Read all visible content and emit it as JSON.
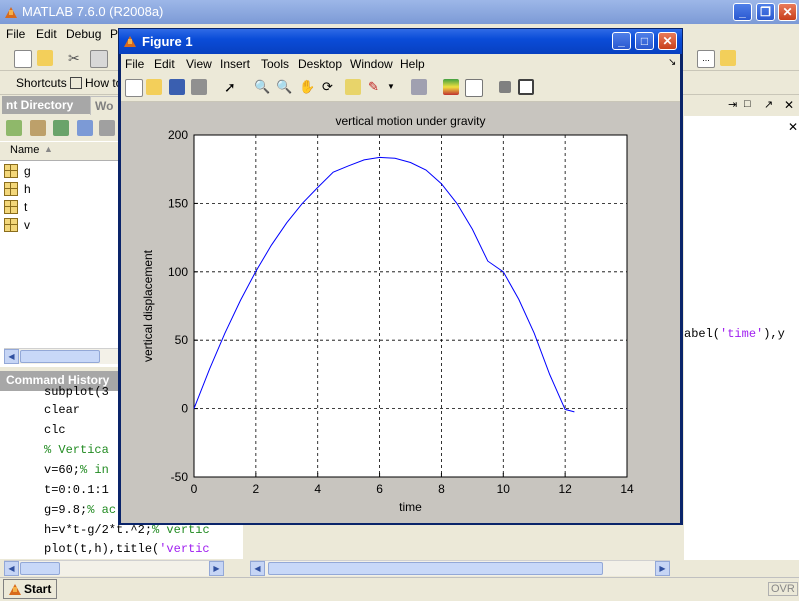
{
  "main_window": {
    "title": "MATLAB  7.6.0 (R2008a)",
    "menu": [
      "File",
      "Edit",
      "Debug",
      "P"
    ],
    "shortcuts_label": "Shortcuts",
    "howto_label": "How to"
  },
  "current_directory": {
    "tab_label": "nt Directory",
    "tab2_label": "Wo",
    "column_name": "Name",
    "files": [
      "g",
      "h",
      "t",
      "v"
    ]
  },
  "command_history": {
    "title": "Command History",
    "lines": [
      {
        "text": "subplot(3",
        "kind": "code"
      },
      {
        "text": "clear",
        "kind": "code"
      },
      {
        "text": "clc",
        "kind": "code"
      },
      {
        "text": "% Vertica",
        "kind": "comment"
      },
      {
        "code": "v=60;",
        "comment": "% in"
      },
      {
        "text": "t=0:0.1:1",
        "kind": "code"
      },
      {
        "code": "g=9.8;",
        "comment": "% ac"
      },
      {
        "code": "h=v*t-g/2*t.^2;",
        "comment": "% vertic"
      },
      {
        "code": "plot(t,h),title(",
        "string": "'vertic"
      }
    ]
  },
  "command_window": {
    "partial_line_pre": "abel(",
    "partial_line_str": "'time'",
    "partial_line_post": "),y"
  },
  "status_bar": {
    "start_label": "Start",
    "ovr_label": "OVR"
  },
  "figure_window": {
    "title": "Figure 1",
    "menu": [
      "File",
      "Edit",
      "View",
      "Insert",
      "Tools",
      "Desktop",
      "Window",
      "Help"
    ]
  },
  "chart_data": {
    "type": "line",
    "title": "vertical motion under gravity",
    "xlabel": "time",
    "ylabel": "vertical displacement",
    "xlim": [
      0,
      14
    ],
    "ylim": [
      -50,
      200
    ],
    "xticks": [
      0,
      2,
      4,
      6,
      8,
      10,
      12,
      14
    ],
    "yticks": [
      -50,
      0,
      50,
      100,
      150,
      200
    ],
    "grid": true,
    "series_color": "#0000ff",
    "series": [
      {
        "x": [
          0,
          0.5,
          1,
          1.5,
          2,
          2.5,
          3,
          3.5,
          4,
          4.5,
          5,
          5.5,
          6,
          6.5,
          7,
          7.5,
          8,
          8.5,
          9,
          9.5,
          10,
          10.5,
          11,
          11.5,
          12,
          12.3
        ],
        "values": [
          0,
          28.8,
          55.1,
          79.0,
          100.4,
          119.4,
          135.9,
          150.0,
          161.6,
          172.8,
          177.5,
          181.8,
          183.6,
          183.0,
          179.9,
          174.4,
          164.4,
          150.0,
          131.1,
          107.8,
          100.0,
          79.8,
          55.1,
          24.9,
          -0.6,
          -2.4
        ]
      }
    ]
  }
}
